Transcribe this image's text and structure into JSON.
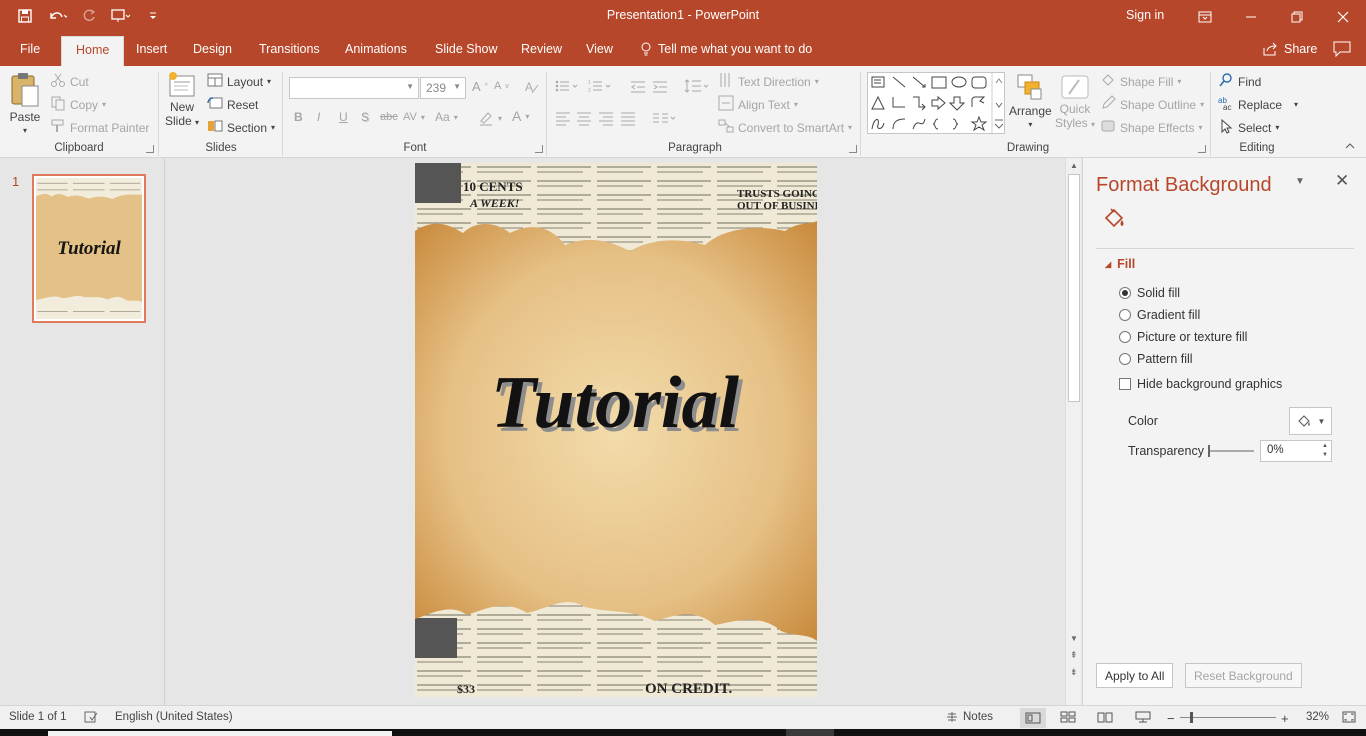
{
  "window": {
    "title": "Presentation1  -  PowerPoint",
    "sign_in": "Sign in"
  },
  "tabs": [
    "File",
    "Home",
    "Insert",
    "Design",
    "Transitions",
    "Animations",
    "Slide Show",
    "Review",
    "View"
  ],
  "tell_me": "Tell me what you want to do",
  "share": "Share",
  "ribbon": {
    "clipboard": {
      "label": "Clipboard",
      "paste": "Paste",
      "cut": "Cut",
      "copy": "Copy",
      "format_painter": "Format Painter"
    },
    "slides": {
      "label": "Slides",
      "new_slide_1": "New",
      "new_slide_2": "Slide",
      "layout": "Layout",
      "reset": "Reset",
      "section": "Section"
    },
    "font": {
      "label": "Font",
      "font_name": "",
      "font_size": "239",
      "bold": "B",
      "italic": "I",
      "underline": "U",
      "shadow": "S",
      "strike": "abc",
      "spacing": "AV",
      "case": "Aa"
    },
    "paragraph": {
      "label": "Paragraph",
      "text_direction": "Text Direction",
      "align_text": "Align Text",
      "convert_smartart": "Convert to SmartArt"
    },
    "drawing": {
      "label": "Drawing",
      "arrange": "Arrange",
      "quick_styles_1": "Quick",
      "quick_styles_2": "Styles",
      "shape_fill": "Shape Fill",
      "shape_outline": "Shape Outline",
      "shape_effects": "Shape Effects"
    },
    "editing": {
      "label": "Editing",
      "find": "Find",
      "replace": "Replace",
      "select": "Select"
    }
  },
  "thumbnails": [
    {
      "number": "1",
      "title": "Tutorial"
    }
  ],
  "slide": {
    "title": "Tutorial"
  },
  "format_background": {
    "title": "Format Background",
    "section": "Fill",
    "options": [
      {
        "label": "Solid fill",
        "selected": true
      },
      {
        "label": "Gradient fill",
        "selected": false
      },
      {
        "label": "Picture or texture fill",
        "selected": false
      },
      {
        "label": "Pattern fill",
        "selected": false
      }
    ],
    "hide_graphics": "Hide background graphics",
    "color_label": "Color",
    "transparency_label": "Transparency",
    "transparency_value": "0%",
    "apply_all": "Apply to All",
    "reset_background": "Reset Background"
  },
  "status": {
    "slide_of": "Slide 1 of 1",
    "language": "English (United States)",
    "notes": "Notes",
    "zoom": "32%"
  },
  "colors": {
    "accent": "#b7472a",
    "ribbon": "#f3f3f3",
    "paper": "#e8c98a"
  }
}
